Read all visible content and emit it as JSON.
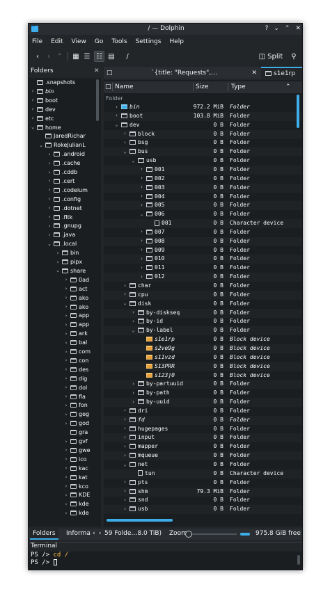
{
  "window": {
    "title": "/ — Dolphin",
    "buttons": [
      "?",
      "⌄",
      "⌃",
      "✕"
    ]
  },
  "menu": [
    "File",
    "Edit",
    "View",
    "Go",
    "Tools",
    "Settings",
    "Help"
  ],
  "toolbar": {
    "path": "/",
    "split_label": "Split"
  },
  "folders_panel": {
    "title": "Folders",
    "items": [
      {
        "label": ".snapshots",
        "indent": 0,
        "chev": ""
      },
      {
        "label": "bin",
        "indent": 0,
        "chev": "›",
        "italic": true
      },
      {
        "label": "boot",
        "indent": 0,
        "chev": "›"
      },
      {
        "label": "dev",
        "indent": 0,
        "chev": "›"
      },
      {
        "label": "etc",
        "indent": 0,
        "chev": "›"
      },
      {
        "label": "home",
        "indent": 0,
        "chev": "⌄"
      },
      {
        "label": "JaredRichar",
        "indent": 1,
        "chev": ""
      },
      {
        "label": "RokeJulianL",
        "indent": 1,
        "chev": "⌄",
        "home": true
      },
      {
        "label": ".android",
        "indent": 2,
        "chev": "›"
      },
      {
        "label": ".cache",
        "indent": 2,
        "chev": "›"
      },
      {
        "label": ".cddb",
        "indent": 2,
        "chev": "›"
      },
      {
        "label": ".cert",
        "indent": 2,
        "chev": "›"
      },
      {
        "label": ".codeium",
        "indent": 2,
        "chev": "›"
      },
      {
        "label": ".config",
        "indent": 2,
        "chev": "›"
      },
      {
        "label": ".dotnet",
        "indent": 2,
        "chev": "›"
      },
      {
        "label": ".fltk",
        "indent": 2,
        "chev": "›"
      },
      {
        "label": ".gnupg",
        "indent": 2,
        "chev": "›"
      },
      {
        "label": ".java",
        "indent": 2,
        "chev": "›"
      },
      {
        "label": ".local",
        "indent": 2,
        "chev": "⌄"
      },
      {
        "label": "bin",
        "indent": 3,
        "chev": "›"
      },
      {
        "label": "pipx",
        "indent": 3,
        "chev": "›"
      },
      {
        "label": "share",
        "indent": 3,
        "chev": "⌄"
      },
      {
        "label": "0ad",
        "indent": 4,
        "chev": "›"
      },
      {
        "label": "act",
        "indent": 4,
        "chev": "›"
      },
      {
        "label": "ako",
        "indent": 4,
        "chev": "›"
      },
      {
        "label": "ako",
        "indent": 4,
        "chev": "›"
      },
      {
        "label": "app",
        "indent": 4,
        "chev": "›"
      },
      {
        "label": "app",
        "indent": 4,
        "chev": "›"
      },
      {
        "label": "ark",
        "indent": 4,
        "chev": "›"
      },
      {
        "label": "bal",
        "indent": 4,
        "chev": "›"
      },
      {
        "label": "com",
        "indent": 4,
        "chev": "›"
      },
      {
        "label": "con",
        "indent": 4,
        "chev": "›"
      },
      {
        "label": "des",
        "indent": 4,
        "chev": "›"
      },
      {
        "label": "dig",
        "indent": 4,
        "chev": "›"
      },
      {
        "label": "dol",
        "indent": 4,
        "chev": "›"
      },
      {
        "label": "fla",
        "indent": 4,
        "chev": "›"
      },
      {
        "label": "fon",
        "indent": 4,
        "chev": "›"
      },
      {
        "label": "geg",
        "indent": 4,
        "chev": "›"
      },
      {
        "label": "god",
        "indent": 4,
        "chev": "›"
      },
      {
        "label": "gra",
        "indent": 4,
        "chev": ""
      },
      {
        "label": "gvf",
        "indent": 4,
        "chev": "›"
      },
      {
        "label": "gwe",
        "indent": 4,
        "chev": "›"
      },
      {
        "label": "ico",
        "indent": 4,
        "chev": "›"
      },
      {
        "label": "kac",
        "indent": 4,
        "chev": "›"
      },
      {
        "label": "kat",
        "indent": 4,
        "chev": "›"
      },
      {
        "label": "kco",
        "indent": 4,
        "chev": "›"
      },
      {
        "label": "KDE",
        "indent": 4,
        "chev": "›"
      },
      {
        "label": "kde",
        "indent": 4,
        "chev": "›"
      },
      {
        "label": "kde",
        "indent": 4,
        "chev": "›"
      }
    ]
  },
  "tabs": [
    {
      "label": "`{title: \"Requests\",…",
      "active": false
    },
    {
      "label": "s1e1rp",
      "active": true
    }
  ],
  "columns": {
    "name": "Name",
    "size": "Size",
    "type": "Type"
  },
  "group_label": "Folder",
  "rows": [
    {
      "name": "bin",
      "indent": 0,
      "chev": "›",
      "icon": "sys",
      "size": "972.2 MiB",
      "type": "Folder",
      "italic": true
    },
    {
      "name": "boot",
      "indent": 0,
      "chev": "›",
      "icon": "folder",
      "size": "103.8 MiB",
      "type": "Folder"
    },
    {
      "name": "dev",
      "indent": 0,
      "chev": "⌄",
      "icon": "folder",
      "size": "0 B",
      "type": "Folder"
    },
    {
      "name": "block",
      "indent": 1,
      "chev": "›",
      "icon": "folder",
      "size": "0 B",
      "type": "Folder"
    },
    {
      "name": "bsg",
      "indent": 1,
      "chev": "›",
      "icon": "folder",
      "size": "0 B",
      "type": "Folder"
    },
    {
      "name": "bus",
      "indent": 1,
      "chev": "⌄",
      "icon": "folder",
      "size": "0 B",
      "type": "Folder"
    },
    {
      "name": "usb",
      "indent": 2,
      "chev": "⌄",
      "icon": "folder",
      "size": "0 B",
      "type": "Folder"
    },
    {
      "name": "001",
      "indent": 3,
      "chev": "›",
      "icon": "folder",
      "size": "0 B",
      "type": "Folder"
    },
    {
      "name": "002",
      "indent": 3,
      "chev": "›",
      "icon": "folder",
      "size": "0 B",
      "type": "Folder"
    },
    {
      "name": "003",
      "indent": 3,
      "chev": "›",
      "icon": "folder",
      "size": "0 B",
      "type": "Folder"
    },
    {
      "name": "004",
      "indent": 3,
      "chev": "›",
      "icon": "folder",
      "size": "0 B",
      "type": "Folder"
    },
    {
      "name": "005",
      "indent": 3,
      "chev": "›",
      "icon": "folder",
      "size": "0 B",
      "type": "Folder"
    },
    {
      "name": "006",
      "indent": 3,
      "chev": "⌄",
      "icon": "folder",
      "size": "0 B",
      "type": "Folder"
    },
    {
      "name": "001",
      "indent": 4,
      "chev": "",
      "icon": "file",
      "size": "0 B",
      "type": "Character device"
    },
    {
      "name": "007",
      "indent": 3,
      "chev": "›",
      "icon": "folder",
      "size": "0 B",
      "type": "Folder"
    },
    {
      "name": "008",
      "indent": 3,
      "chev": "›",
      "icon": "folder",
      "size": "0 B",
      "type": "Folder"
    },
    {
      "name": "009",
      "indent": 3,
      "chev": "›",
      "icon": "folder",
      "size": "0 B",
      "type": "Folder"
    },
    {
      "name": "010",
      "indent": 3,
      "chev": "›",
      "icon": "folder",
      "size": "0 B",
      "type": "Folder"
    },
    {
      "name": "011",
      "indent": 3,
      "chev": "›",
      "icon": "folder",
      "size": "0 B",
      "type": "Folder"
    },
    {
      "name": "012",
      "indent": 3,
      "chev": "›",
      "icon": "folder",
      "size": "0 B",
      "type": "Folder"
    },
    {
      "name": "char",
      "indent": 1,
      "chev": "›",
      "icon": "folder",
      "size": "0 B",
      "type": "Folder"
    },
    {
      "name": "cpu",
      "indent": 1,
      "chev": "›",
      "icon": "folder",
      "size": "0 B",
      "type": "Folder"
    },
    {
      "name": "disk",
      "indent": 1,
      "chev": "⌄",
      "icon": "folder",
      "size": "0 B",
      "type": "Folder"
    },
    {
      "name": "by-diskseq",
      "indent": 2,
      "chev": "›",
      "icon": "folder",
      "size": "0 B",
      "type": "Folder"
    },
    {
      "name": "by-id",
      "indent": 2,
      "chev": "›",
      "icon": "folder",
      "size": "0 B",
      "type": "Folder"
    },
    {
      "name": "by-label",
      "indent": 2,
      "chev": "⌄",
      "icon": "folder",
      "size": "0 B",
      "type": "Folder"
    },
    {
      "name": "s1e1rp",
      "indent": 3,
      "chev": "",
      "icon": "dev",
      "size": "0 B",
      "type": "Block device",
      "italic": true
    },
    {
      "name": "s2ve9g",
      "indent": 3,
      "chev": "",
      "icon": "dev",
      "size": "0 B",
      "type": "Block device",
      "italic": true
    },
    {
      "name": "s11vzd",
      "indent": 3,
      "chev": "",
      "icon": "dev",
      "size": "0 B",
      "type": "Block device",
      "italic": true
    },
    {
      "name": "S13PRR",
      "indent": 3,
      "chev": "",
      "icon": "dev",
      "size": "0 B",
      "type": "Block device",
      "italic": true
    },
    {
      "name": "s123j0",
      "indent": 3,
      "chev": "",
      "icon": "dev",
      "size": "0 B",
      "type": "Block device",
      "italic": true
    },
    {
      "name": "by-partuuid",
      "indent": 2,
      "chev": "›",
      "icon": "folder",
      "size": "0 B",
      "type": "Folder"
    },
    {
      "name": "by-path",
      "indent": 2,
      "chev": "›",
      "icon": "folder",
      "size": "0 B",
      "type": "Folder"
    },
    {
      "name": "by-uuid",
      "indent": 2,
      "chev": "›",
      "icon": "folder",
      "size": "0 B",
      "type": "Folder"
    },
    {
      "name": "dri",
      "indent": 1,
      "chev": "›",
      "icon": "folder",
      "size": "0 B",
      "type": "Folder"
    },
    {
      "name": "fd",
      "indent": 1,
      "chev": "›",
      "icon": "folder",
      "size": "0 B",
      "type": "Folder",
      "italic": true
    },
    {
      "name": "hugepages",
      "indent": 1,
      "chev": "›",
      "icon": "folder",
      "size": "0 B",
      "type": "Folder"
    },
    {
      "name": "input",
      "indent": 1,
      "chev": "›",
      "icon": "folder",
      "size": "0 B",
      "type": "Folder"
    },
    {
      "name": "mapper",
      "indent": 1,
      "chev": "›",
      "icon": "folder",
      "size": "0 B",
      "type": "Folder"
    },
    {
      "name": "mqueue",
      "indent": 1,
      "chev": "›",
      "icon": "folder",
      "size": "0 B",
      "type": "Folder"
    },
    {
      "name": "net",
      "indent": 1,
      "chev": "⌄",
      "icon": "folder",
      "size": "0 B",
      "type": "Folder"
    },
    {
      "name": "tun",
      "indent": 2,
      "chev": "",
      "icon": "file",
      "size": "0 B",
      "type": "Character device"
    },
    {
      "name": "pts",
      "indent": 1,
      "chev": "›",
      "icon": "folder",
      "size": "0 B",
      "type": "Folder"
    },
    {
      "name": "shm",
      "indent": 1,
      "chev": "›",
      "icon": "folder",
      "size": "79.3 MiB",
      "type": "Folder"
    },
    {
      "name": "snd",
      "indent": 1,
      "chev": "›",
      "icon": "folder",
      "size": "0 B",
      "type": "Folder"
    },
    {
      "name": "usb",
      "indent": 1,
      "chev": "›",
      "icon": "folder",
      "size": "0 B",
      "type": "Folder"
    }
  ],
  "statusbar": {
    "tab_folders": "Folders",
    "tab_info": "Informa",
    "summary": "59 Folde…8.0 TiB)",
    "zoom_label": "Zoom:",
    "free_space": "975.8 GiB free"
  },
  "terminal": {
    "title": "Terminal",
    "line1_prompt": "PS />",
    "line1_cmd": "cd /",
    "line2_prompt": "PS />"
  }
}
